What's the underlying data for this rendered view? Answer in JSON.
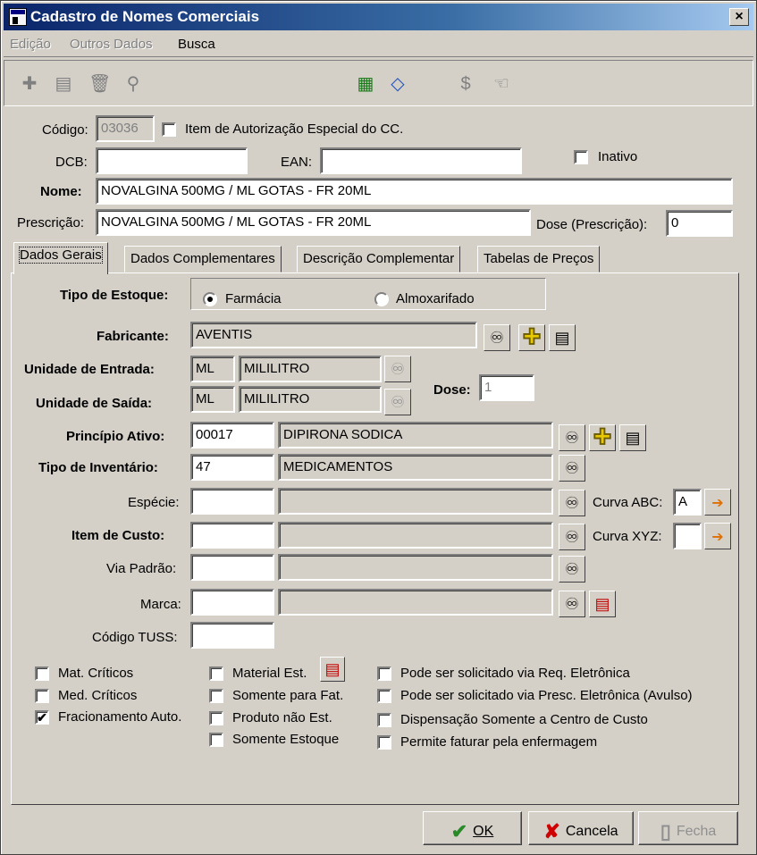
{
  "window": {
    "title": "Cadastro de Nomes Comerciais",
    "close": "×"
  },
  "menu": [
    "Edição",
    "Outros Dados",
    "Busca"
  ],
  "toolbar": {
    "icons": [
      "plus-icon",
      "edit-icon",
      "trash-icon",
      "binoculars-icon",
      "excel-icon",
      "eraser-icon",
      "dollar-icon",
      "hand-icon"
    ],
    "glyphs": {
      "plus": "✚",
      "edit": "▤",
      "trash": "🗑",
      "find": "⚲",
      "excel": "▦",
      "eraser": "◇",
      "dollar": "$",
      "hand": "☜"
    }
  },
  "header": {
    "codigo_label": "Código:",
    "codigo_value": "03036",
    "item_autorizacao_label": "Item de Autorização Especial do CC.",
    "dcb_label": "DCB:",
    "dcb_value": "",
    "ean_label": "EAN:",
    "ean_value": "",
    "inativo_label": "Inativo",
    "nome_label": "Nome:",
    "nome_value": "NOVALGINA 500MG / ML GOTAS - FR 20ML",
    "prescricao_label": "Prescrição:",
    "prescricao_value": "NOVALGINA 500MG / ML GOTAS - FR 20ML",
    "dose_prescricao_label": "Dose (Prescrição):",
    "dose_prescricao_value": "0"
  },
  "tabs": [
    "Dados Gerais",
    "Dados Complementares",
    "Descrição Complementar",
    "Tabelas de Preços"
  ],
  "dados_gerais": {
    "tipo_estoque_label": "Tipo de Estoque:",
    "farmacia_label": "Farmácia",
    "almoxarifado_label": "Almoxarifado",
    "fabricante_label": "Fabricante:",
    "fabricante_value": "AVENTIS",
    "unidade_entrada_label": "Unidade de Entrada:",
    "unidade_entrada_code": "ML",
    "unidade_entrada_desc": "MILILITRO",
    "unidade_saida_label": "Unidade de Saída:",
    "unidade_saida_code": "ML",
    "unidade_saida_desc": "MILILITRO",
    "dose_label": "Dose:",
    "dose_value": "1",
    "principio_ativo_label": "Princípio Ativo:",
    "principio_ativo_code": "00017",
    "principio_ativo_desc": "DIPIRONA SODICA",
    "tipo_inventario_label": "Tipo de Inventário:",
    "tipo_inventario_code": "47",
    "tipo_inventario_desc": "MEDICAMENTOS",
    "especie_label": "Espécie:",
    "curva_abc_label": "Curva ABC:",
    "curva_abc_value": "A",
    "item_custo_label": "Item de Custo:",
    "curva_xyz_label": "Curva XYZ:",
    "curva_xyz_value": "",
    "via_padrao_label": "Via Padrão:",
    "marca_label": "Marca:",
    "codigo_tuss_label": "Código TUSS:",
    "checks_col1": [
      {
        "label": "Mat. Críticos",
        "checked": false
      },
      {
        "label": "Med. Críticos",
        "checked": false
      },
      {
        "label": "Fracionamento Auto.",
        "checked": true
      }
    ],
    "checks_col2": [
      {
        "label": "Material Est.",
        "checked": false
      },
      {
        "label": "Somente para  Fat.",
        "checked": false
      },
      {
        "label": "Produto não Est.",
        "checked": false
      },
      {
        "label": "Somente Estoque",
        "checked": false
      }
    ],
    "checks_col3": [
      {
        "label": "Pode ser solicitado via Req. Eletrônica",
        "checked": false
      },
      {
        "label": "Pode ser solicitado via Presc. Eletrônica  (Avulso)",
        "checked": false
      },
      {
        "label": "Dispensação Somente a Centro de Custo",
        "checked": false
      },
      {
        "label": "Permite faturar pela enfermagem",
        "checked": false
      }
    ]
  },
  "buttons": {
    "ok": "OK",
    "ok_icon": "✔",
    "cancela": "Cancela",
    "cancela_icon": "✘",
    "fecha": "Fecha",
    "fecha_icon": "▯"
  },
  "icons": {
    "binoculars": "♾",
    "plus": "✚",
    "edit": "▤",
    "arrow": "➔",
    "check": "✔"
  },
  "colors": {
    "titlebar_start": "#0a246a",
    "titlebar_end": "#a6caf0",
    "ok_icon": "#2a8a2a",
    "cancel_icon": "#d00000",
    "face": "#d4d0c8"
  }
}
